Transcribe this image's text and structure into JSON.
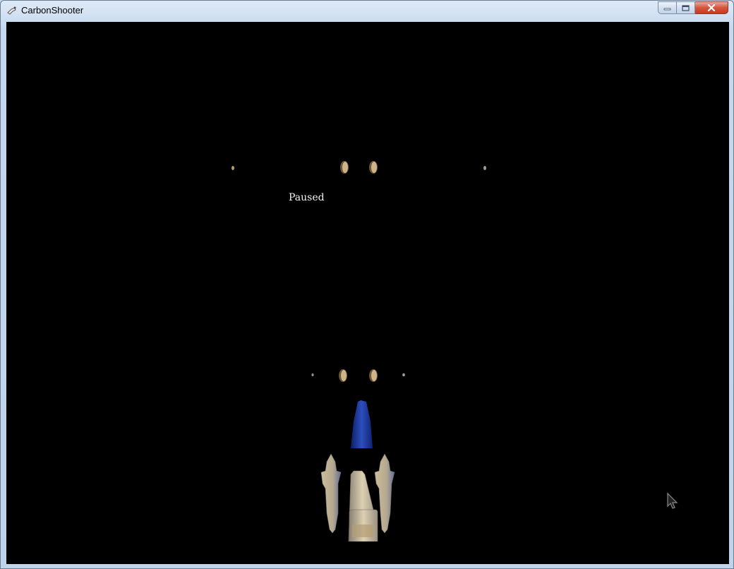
{
  "window": {
    "title": "CarbonShooter",
    "controls": {
      "minimize": "minimize",
      "maximize": "maximize",
      "close": "close"
    }
  },
  "game": {
    "status_text": "Paused",
    "background_color": "#000000",
    "player_ship": {
      "body_color": "#cbbd9e",
      "nose_color": "#1c3a9a"
    },
    "enemy_color": "#c8aa80"
  },
  "icons": [
    "app-icon",
    "minimize-icon",
    "maximize-icon",
    "close-icon",
    "mouse-cursor-icon"
  ]
}
